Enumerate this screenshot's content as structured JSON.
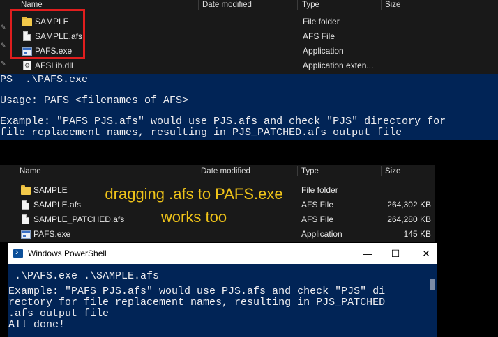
{
  "top_explorer": {
    "columns": [
      "Name",
      "Date modified",
      "Type",
      "Size"
    ],
    "files": [
      {
        "name": "SAMPLE",
        "type": "File folder",
        "icon": "folder-icon"
      },
      {
        "name": "SAMPLE.afs",
        "type": "AFS File",
        "icon": "file-icon"
      },
      {
        "name": "PAFS.exe",
        "type": "Application",
        "icon": "exe-icon"
      },
      {
        "name": "AFSLib.dll",
        "type": "Application exten...",
        "icon": "dll-icon"
      }
    ]
  },
  "top_console": {
    "lines": [
      "PS  .\\PAFS.exe",
      "",
      "Usage: PAFS <filenames of AFS>",
      "",
      "Example: \"PAFS PJS.afs\" would use PJS.afs and check \"PJS\" directory for",
      "file replacement names, resulting in PJS_PATCHED.afs output file"
    ]
  },
  "bottom_explorer": {
    "columns": [
      "Name",
      "Date modified",
      "Type",
      "Size"
    ],
    "files": [
      {
        "name": "SAMPLE",
        "type": "File folder",
        "size": "",
        "icon": "folder-icon"
      },
      {
        "name": "SAMPLE.afs",
        "type": "AFS File",
        "size": "264,302 KB",
        "icon": "file-icon"
      },
      {
        "name": "SAMPLE_PATCHED.afs",
        "type": "AFS File",
        "size": "264,280 KB",
        "icon": "file-icon"
      },
      {
        "name": "PAFS.exe",
        "type": "Application",
        "size": "145 KB",
        "icon": "exe-icon"
      }
    ]
  },
  "annotation": {
    "line1": "dragging .afs to PAFS.exe",
    "line2": "works too"
  },
  "powershell": {
    "title": "Windows PowerShell",
    "minimize": "—",
    "maximize": "☐",
    "close": "✕",
    "lines": [
      " .\\PAFS.exe .\\SAMPLE.afs",
      "Example: \"PAFS PJS.afs\" would use PJS.afs and check \"PJS\" di",
      "rectory for file replacement names, resulting in PJS_PATCHED",
      ".afs output file",
      "All done!"
    ]
  },
  "colors": {
    "console_bg": "#012456",
    "highlight": "#e01e1e",
    "annotation": "#f0c419"
  }
}
